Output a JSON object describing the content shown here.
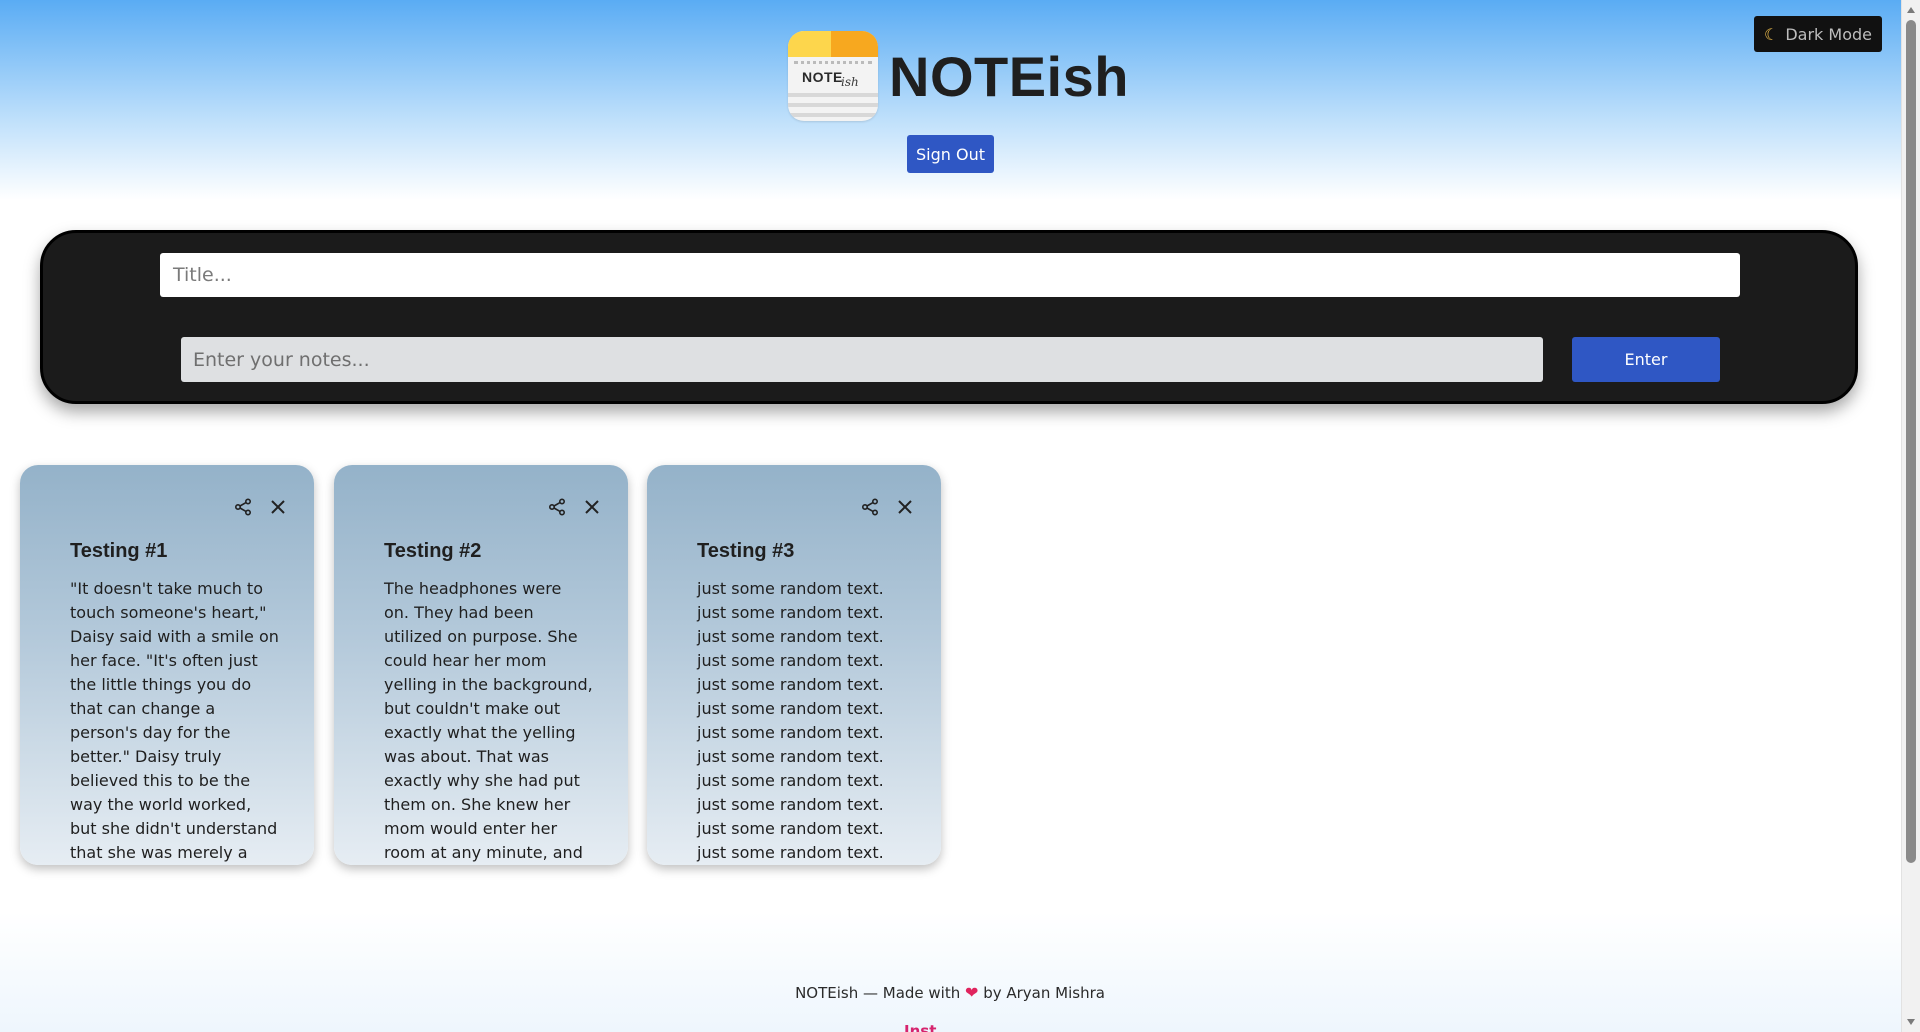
{
  "header": {
    "title": "NOTEish",
    "logo_text": "NOTE",
    "logo_script": "ish",
    "dark_mode_label": "Dark Mode",
    "sign_out_label": "Sign Out"
  },
  "composer": {
    "title_placeholder": "Title...",
    "notes_placeholder": "Enter your notes...",
    "enter_label": "Enter"
  },
  "notes": [
    {
      "title": "Testing #1",
      "body": "\"It doesn't take much to\ntouch someone's heart,\"\nDaisy said with a smile on\nher face. \"It's often just\nthe little things you do\nthat can change a\nperson's day for the\nbetter.\" Daisy truly\nbelieved this to be the\nway the world worked,\nbut she didn't understand\nthat she was merely a"
    },
    {
      "title": "Testing #2",
      "body": "The headphones were\non. They had been\nutilized on purpose. She\ncould hear her mom\nyelling in the background,\nbut couldn't make out\nexactly what the yelling\nwas about. That was\nexactly why she had put\nthem on. She knew her\nmom would enter her\nroom at any minute, and"
    },
    {
      "title": "Testing #3",
      "body": "just some random text.\njust some random text.\njust some random text.\njust some random text.\njust some random text.\njust some random text.\njust some random text.\njust some random text.\njust some random text.\njust some random text.\njust some random text.\njust some random text."
    }
  ],
  "footer": {
    "text_before": "NOTEish — Made with",
    "heart": "❤",
    "text_after": "by Aryan Mishra",
    "link_partial": "Inst"
  },
  "icons": {
    "dark_mode": "moon-icon",
    "share": "share-icon",
    "delete": "close-icon",
    "heart": "heart-icon"
  },
  "colors": {
    "primary_button": "#2f57c4",
    "composer_bg": "#1b1b1b",
    "card_top": "#94b2c9",
    "card_bottom": "#e6edf3"
  }
}
